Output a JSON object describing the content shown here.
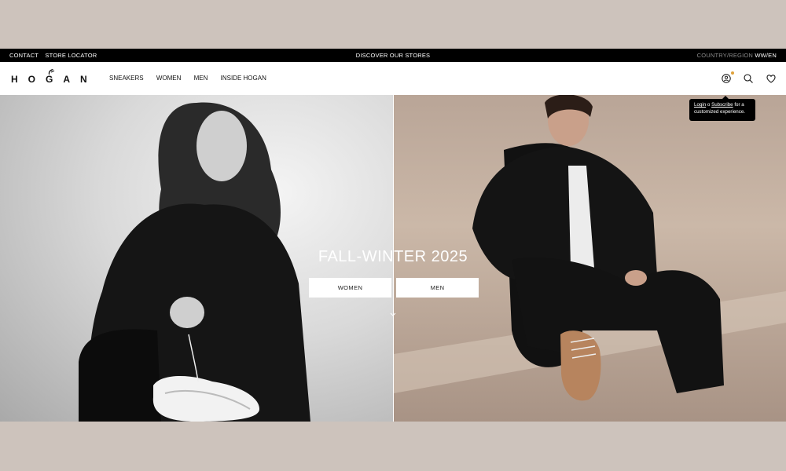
{
  "topbar": {
    "contact": "CONTACT",
    "store_locator": "STORE LOCATOR",
    "discover": "DISCOVER OUR STORES",
    "country_label": "COUNTRY/REGION",
    "country_value": "WW/EN"
  },
  "header": {
    "logo_text": "HOGAN",
    "nav": [
      "SNEAKERS",
      "WOMEN",
      "MEN",
      "INSIDE HOGAN"
    ]
  },
  "tooltip": {
    "login": "Login",
    "or": "o",
    "subscribe": "Subscribe",
    "suffix": "for a customized experience."
  },
  "hero": {
    "title": "FALL-WINTER 2025",
    "cta_women": "WOMEN",
    "cta_men": "MEN"
  },
  "icons": [
    "account-icon",
    "search-icon",
    "heart-icon",
    "chevron-down-icon"
  ],
  "colors": {
    "notification_dot": "#e0a23b",
    "page_bg": "#cdc3bc"
  }
}
